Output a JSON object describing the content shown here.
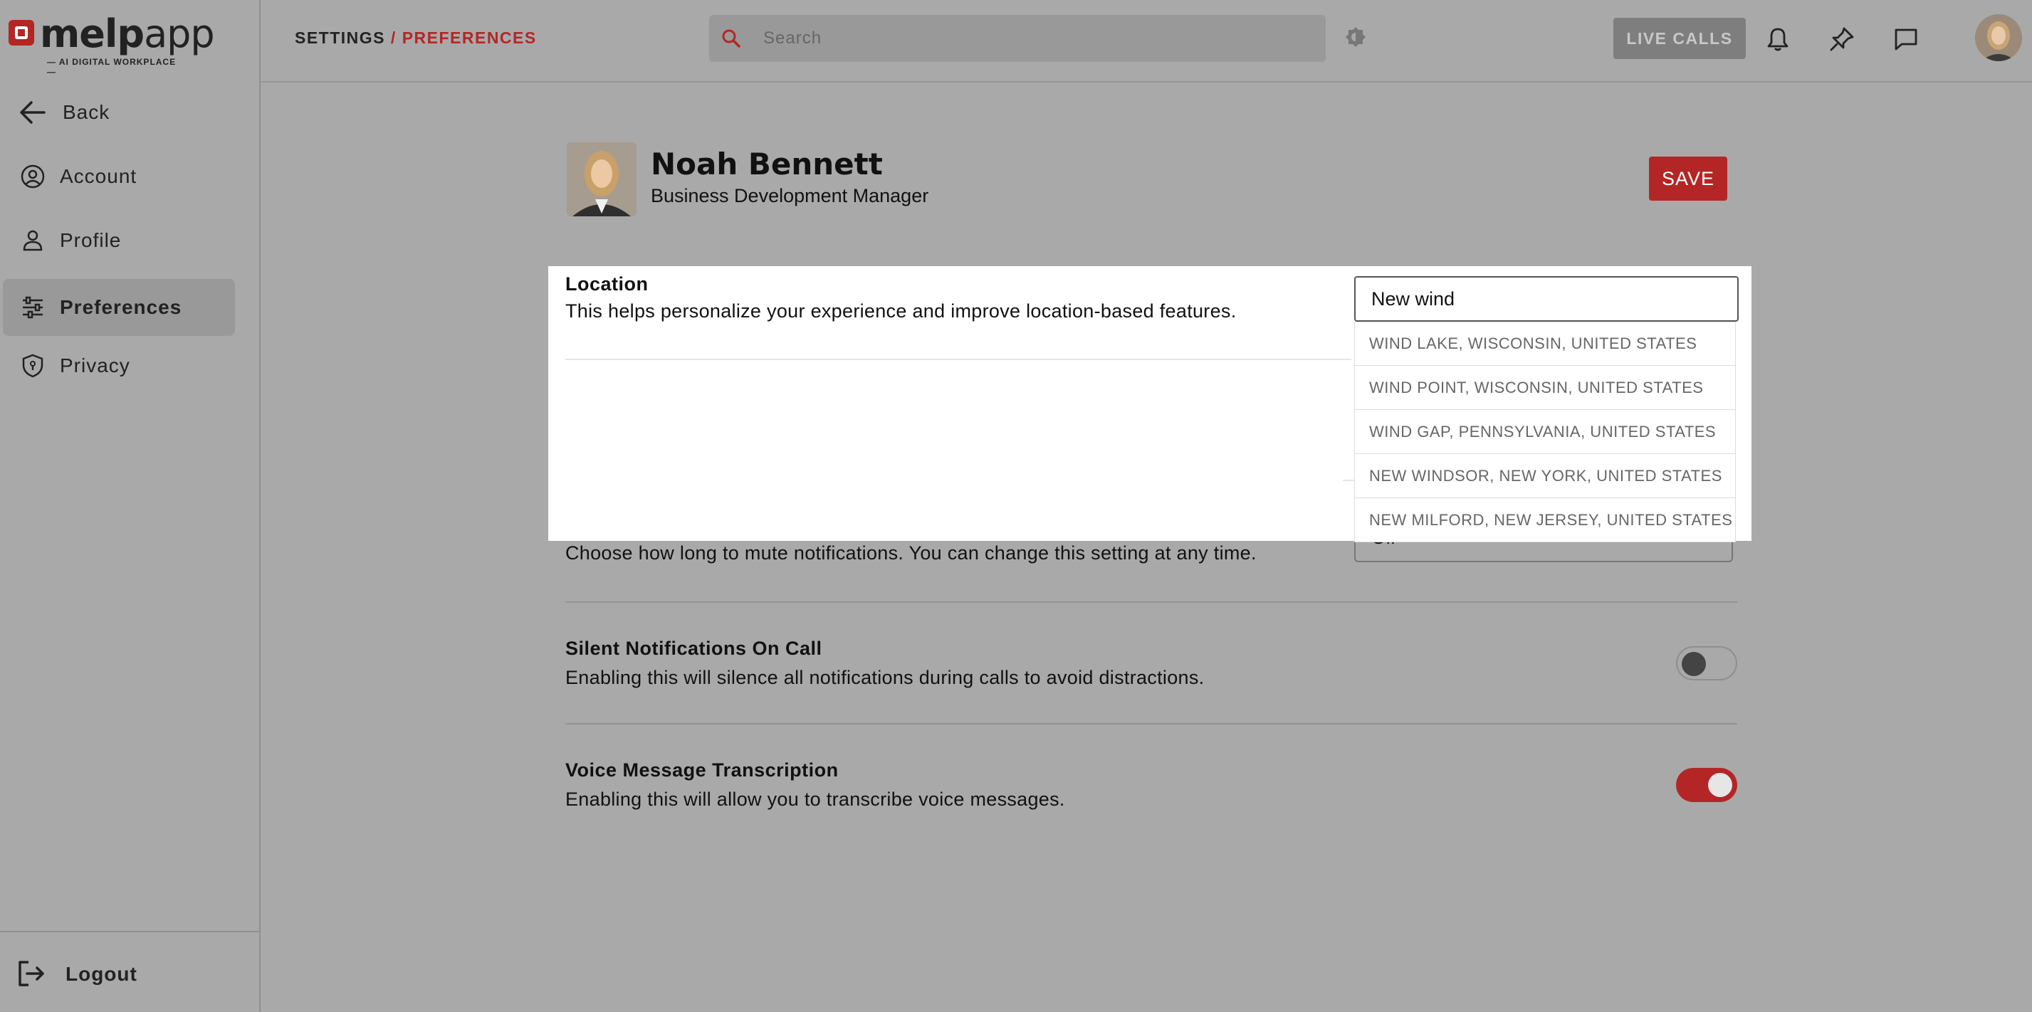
{
  "brand": {
    "name_bold": "melp",
    "name_light": "app",
    "tagline": "— AI DIGITAL WORKPLACE —",
    "accent": "#b42626"
  },
  "sidebar": {
    "back_label": "Back",
    "items": [
      {
        "label": "Account",
        "icon": "account-icon"
      },
      {
        "label": "Profile",
        "icon": "profile-icon"
      },
      {
        "label": "Preferences",
        "icon": "sliders-icon",
        "active": true
      },
      {
        "label": "Privacy",
        "icon": "shield-icon"
      }
    ],
    "logout_label": "Logout"
  },
  "header": {
    "breadcrumb_root": "SETTINGS",
    "breadcrumb_sep": "/",
    "breadcrumb_current": "PREFERENCES",
    "search_placeholder": "Search",
    "live_calls_label": "LIVE CALLS"
  },
  "profile": {
    "name": "Noah Bennett",
    "role": "Business Development Manager",
    "save_label": "SAVE"
  },
  "location": {
    "title": "Location",
    "description": "This helps personalize your experience and improve location-based features.",
    "input_value": "New wind",
    "suggestions": [
      "WIND LAKE, WISCONSIN, UNITED STATES",
      "WIND POINT, WISCONSIN, UNITED STATES",
      "WIND GAP, PENNSYLVANIA, UNITED STATES",
      "NEW WINDSOR, NEW YORK, UNITED STATES",
      "NEW MILFORD, NEW JERSEY, UNITED STATES"
    ]
  },
  "mute": {
    "description": "Choose how long to mute notifications. You can change this setting at any time.",
    "selected_partial": "Off"
  },
  "silent_calls": {
    "title": "Silent Notifications On Call",
    "description": "Enabling this will silence all notifications during calls to avoid distractions.",
    "enabled": false
  },
  "voice_transcription": {
    "title": "Voice Message Transcription",
    "description": "Enabling this will allow you to transcribe voice messages.",
    "enabled": true
  }
}
